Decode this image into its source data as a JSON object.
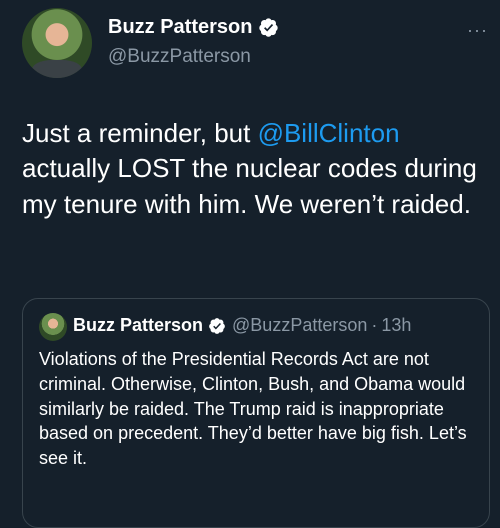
{
  "tweet": {
    "author": {
      "display_name": "Buzz Patterson",
      "handle": "@BuzzPatterson",
      "verified_icon": "verified-badge-icon"
    },
    "more_label": "···",
    "text": {
      "part1": "Just a reminder, but ",
      "mention": "@BillClinton",
      "part2": " actually LOST the nuclear codes during my tenure with him. We weren’t raided."
    }
  },
  "quoted_tweet": {
    "author": {
      "display_name": "Buzz Patterson",
      "handle": "@BuzzPatterson",
      "verified_icon": "verified-badge-icon"
    },
    "separator": "·",
    "time": "13h",
    "text": "Violations of the Presidential Records Act are not criminal. Otherwise, Clinton, Bush, and Obama would similarly be raided. The Trump raid is inappropriate based on precedent. They’d better have big fish. Let’s see it."
  },
  "colors": {
    "background": "#15202b",
    "text": "#ffffff",
    "secondary_text": "#8b98a5",
    "accent": "#1d9bf0",
    "border": "#38444d"
  }
}
